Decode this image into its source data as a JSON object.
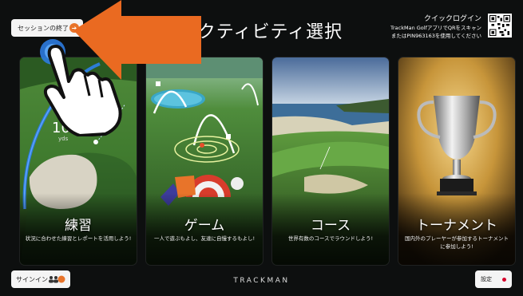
{
  "header": {
    "end_session_label": "セッションの終了",
    "title": "アクティビティ選択",
    "quick_login_title": "クイックログイン",
    "quick_login_line1": "TrackMan GolfアプリでQRをスキャン",
    "quick_login_line2": "またはPIN9631​63を使用してください"
  },
  "cards": [
    {
      "title": "練習",
      "desc": "状況に合わせた練習とレポートを活用しよう!",
      "overlay_number": "109",
      "overlay_unit": "yds"
    },
    {
      "title": "ゲーム",
      "desc": "一人で遊ぶもよし、友達に自慢するもよし!"
    },
    {
      "title": "コース",
      "desc": "世界有数のコースでラウンドしよう!"
    },
    {
      "title": "トーナメント",
      "desc": "国内外のプレーヤーが参加するトーナメントに参加しよう!"
    }
  ],
  "footer": {
    "signin_label": "サインイン",
    "brand": "TRACKMAN",
    "settings_label": "設定"
  },
  "colors": {
    "accent_orange": "#e8742a",
    "setting_dot": "#d6002b"
  }
}
